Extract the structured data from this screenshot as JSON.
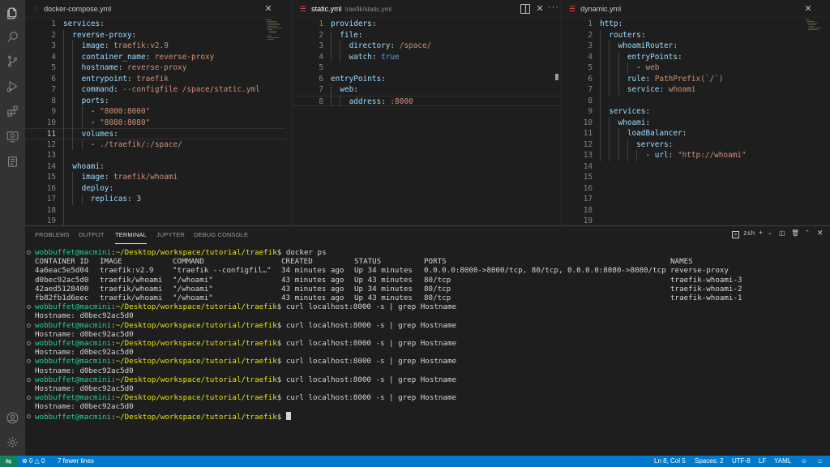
{
  "activity_bar": [
    {
      "name": "explorer-icon"
    },
    {
      "name": "search-icon"
    },
    {
      "name": "source-control-icon"
    },
    {
      "name": "run-debug-icon"
    },
    {
      "name": "extensions-icon"
    },
    {
      "name": "remote-explorer-icon"
    },
    {
      "name": "docker-icon"
    },
    {
      "name": "account-icon"
    },
    {
      "name": "settings-gear-icon"
    }
  ],
  "editors": {
    "compose": {
      "tab_label": "docker-compose.yml",
      "lines": [
        {
          "n": "1",
          "t": [
            [
              "k",
              "services"
            ],
            [
              "p",
              ":"
            ]
          ]
        },
        {
          "n": "2",
          "t": [
            [
              "p",
              "  "
            ],
            [
              "k",
              "reverse-proxy"
            ],
            [
              "p",
              ":"
            ]
          ]
        },
        {
          "n": "3",
          "t": [
            [
              "p",
              "    "
            ],
            [
              "k",
              "image"
            ],
            [
              "p",
              ": "
            ],
            [
              "s",
              "traefik:v2.9"
            ]
          ]
        },
        {
          "n": "4",
          "t": [
            [
              "p",
              "    "
            ],
            [
              "k",
              "container_name"
            ],
            [
              "p",
              ": "
            ],
            [
              "s",
              "reverse-proxy"
            ]
          ]
        },
        {
          "n": "5",
          "t": [
            [
              "p",
              "    "
            ],
            [
              "k",
              "hostname"
            ],
            [
              "p",
              ": "
            ],
            [
              "s",
              "reverse-proxy"
            ]
          ]
        },
        {
          "n": "6",
          "t": [
            [
              "p",
              "    "
            ],
            [
              "k",
              "entrypoint"
            ],
            [
              "p",
              ": "
            ],
            [
              "s",
              "traefik"
            ]
          ]
        },
        {
          "n": "7",
          "t": [
            [
              "p",
              "    "
            ],
            [
              "k",
              "command"
            ],
            [
              "p",
              ": "
            ],
            [
              "s",
              "--configfile /space/static.yml"
            ]
          ]
        },
        {
          "n": "8",
          "t": [
            [
              "p",
              "    "
            ],
            [
              "k",
              "ports"
            ],
            [
              "p",
              ":"
            ]
          ]
        },
        {
          "n": "9",
          "t": [
            [
              "p",
              "      - "
            ],
            [
              "s",
              "\"8000:8000\""
            ]
          ]
        },
        {
          "n": "10",
          "t": [
            [
              "p",
              "      - "
            ],
            [
              "s",
              "\"8080:8080\""
            ]
          ]
        },
        {
          "n": "11",
          "t": [
            [
              "p",
              "    "
            ],
            [
              "k",
              "volumes"
            ],
            [
              "p",
              ":"
            ]
          ]
        },
        {
          "n": "12",
          "t": [
            [
              "p",
              "      - "
            ],
            [
              "s",
              "./traefik/:/space/"
            ]
          ]
        },
        {
          "n": "13",
          "t": []
        },
        {
          "n": "14",
          "t": [
            [
              "p",
              "  "
            ],
            [
              "k",
              "whoami"
            ],
            [
              "p",
              ":"
            ]
          ]
        },
        {
          "n": "15",
          "t": [
            [
              "p",
              "    "
            ],
            [
              "k",
              "image"
            ],
            [
              "p",
              ": "
            ],
            [
              "s",
              "traefik/whoami"
            ]
          ]
        },
        {
          "n": "16",
          "t": [
            [
              "p",
              "    "
            ],
            [
              "k",
              "deploy"
            ],
            [
              "p",
              ":"
            ]
          ]
        },
        {
          "n": "17",
          "t": [
            [
              "p",
              "      "
            ],
            [
              "k",
              "replicas"
            ],
            [
              "p",
              ": "
            ],
            [
              "n",
              "3"
            ]
          ]
        },
        {
          "n": "18",
          "t": []
        },
        {
          "n": "19",
          "t": []
        }
      ]
    },
    "static": {
      "tab_label": "static.yml",
      "tab_path": "traefik/static.yml",
      "lines": [
        {
          "n": "1",
          "t": [
            [
              "k",
              "providers"
            ],
            [
              "p",
              ":"
            ]
          ]
        },
        {
          "n": "2",
          "t": [
            [
              "p",
              "  "
            ],
            [
              "k",
              "file"
            ],
            [
              "p",
              ":"
            ]
          ]
        },
        {
          "n": "3",
          "t": [
            [
              "p",
              "    "
            ],
            [
              "k",
              "directory"
            ],
            [
              "p",
              ": "
            ],
            [
              "s",
              "/space/"
            ]
          ]
        },
        {
          "n": "4",
          "t": [
            [
              "p",
              "    "
            ],
            [
              "k",
              "watch"
            ],
            [
              "p",
              ": "
            ],
            [
              "b",
              "true"
            ]
          ]
        },
        {
          "n": "5",
          "t": []
        },
        {
          "n": "6",
          "t": [
            [
              "k",
              "entryPoints"
            ],
            [
              "p",
              ":"
            ]
          ]
        },
        {
          "n": "7",
          "t": [
            [
              "p",
              "  "
            ],
            [
              "k",
              "web"
            ],
            [
              "p",
              ":"
            ]
          ]
        },
        {
          "n": "8",
          "t": [
            [
              "p",
              "    "
            ],
            [
              "k",
              "address"
            ],
            [
              "p",
              ": "
            ],
            [
              "s",
              ":8000"
            ]
          ]
        }
      ]
    },
    "dynamic": {
      "tab_label": "dynamic.yml",
      "lines": [
        {
          "n": "1",
          "t": [
            [
              "k",
              "http"
            ],
            [
              "p",
              ":"
            ]
          ]
        },
        {
          "n": "2",
          "t": [
            [
              "p",
              "  "
            ],
            [
              "k",
              "routers"
            ],
            [
              "p",
              ":"
            ]
          ]
        },
        {
          "n": "3",
          "t": [
            [
              "p",
              "    "
            ],
            [
              "k",
              "whoamiRouter"
            ],
            [
              "p",
              ":"
            ]
          ]
        },
        {
          "n": "4",
          "t": [
            [
              "p",
              "      "
            ],
            [
              "k",
              "entryPoints"
            ],
            [
              "p",
              ":"
            ]
          ]
        },
        {
          "n": "5",
          "t": [
            [
              "p",
              "        - "
            ],
            [
              "s",
              "web"
            ]
          ]
        },
        {
          "n": "6",
          "t": [
            [
              "p",
              "      "
            ],
            [
              "k",
              "rule"
            ],
            [
              "p",
              ": "
            ],
            [
              "s",
              "PathPrefix(`/`)"
            ]
          ]
        },
        {
          "n": "7",
          "t": [
            [
              "p",
              "      "
            ],
            [
              "k",
              "service"
            ],
            [
              "p",
              ": "
            ],
            [
              "s",
              "whoami"
            ]
          ]
        },
        {
          "n": "8",
          "t": []
        },
        {
          "n": "9",
          "t": [
            [
              "p",
              "  "
            ],
            [
              "k",
              "services"
            ],
            [
              "p",
              ":"
            ]
          ]
        },
        {
          "n": "10",
          "t": [
            [
              "p",
              "    "
            ],
            [
              "k",
              "whoami"
            ],
            [
              "p",
              ":"
            ]
          ]
        },
        {
          "n": "11",
          "t": [
            [
              "p",
              "      "
            ],
            [
              "k",
              "loadBalancer"
            ],
            [
              "p",
              ":"
            ]
          ]
        },
        {
          "n": "12",
          "t": [
            [
              "p",
              "        "
            ],
            [
              "k",
              "servers"
            ],
            [
              "p",
              ":"
            ]
          ]
        },
        {
          "n": "13",
          "t": [
            [
              "p",
              "          - "
            ],
            [
              "k",
              "url"
            ],
            [
              "p",
              ": "
            ],
            [
              "s",
              "\"http://whoami\""
            ]
          ]
        },
        {
          "n": "14",
          "t": []
        },
        {
          "n": "15",
          "t": []
        },
        {
          "n": "16",
          "t": []
        },
        {
          "n": "17",
          "t": []
        },
        {
          "n": "18",
          "t": []
        },
        {
          "n": "19",
          "t": []
        }
      ]
    }
  },
  "panel": {
    "tabs": [
      "PROBLEMS",
      "OUTPUT",
      "TERMINAL",
      "JUPYTER",
      "DEBUG CONSOLE"
    ],
    "active_tab": "TERMINAL",
    "shell": "zsh",
    "prompt_user": "wobbuffet@macmini",
    "prompt_path": "~/Desktop/workspace/tutorial/traefik",
    "docker_ps": {
      "command": "docker ps",
      "headers": [
        "CONTAINER ID",
        "IMAGE",
        "COMMAND",
        "CREATED",
        "STATUS",
        "PORTS",
        "NAMES"
      ],
      "rows": [
        [
          "4a6eac5e5d04",
          "traefik:v2.9",
          "\"traefik --configfil…\"",
          "34 minutes ago",
          "Up 34 minutes",
          "0.0.0.0:8000->8000/tcp, 80/tcp, 0.0.0.0:8080->8080/tcp",
          "reverse-proxy"
        ],
        [
          "d0bec92ac5d0",
          "traefik/whoami",
          "\"/whoami\"",
          "43 minutes ago",
          "Up 43 minutes",
          "80/tcp",
          "traefik-whoami-3"
        ],
        [
          "42aed5128400",
          "traefik/whoami",
          "\"/whoami\"",
          "43 minutes ago",
          "Up 34 minutes",
          "80/tcp",
          "traefik-whoami-2"
        ],
        [
          "fb82fb1d6eec",
          "traefik/whoami",
          "\"/whoami\"",
          "43 minutes ago",
          "Up 43 minutes",
          "80/tcp",
          "traefik-whoami-1"
        ]
      ]
    },
    "curl_command": "curl localhost:8000 -s | grep Hostname",
    "curl_outputs": [
      "Hostname: d0bec92ac5d0",
      "Hostname: d0bec92ac5d0",
      "Hostname: d0bec92ac5d0",
      "Hostname: d0bec92ac5d0",
      "Hostname: d0bec92ac5d0",
      "Hostname: d0bec92ac5d0"
    ]
  },
  "status_bar": {
    "errors": "0",
    "warnings": "0",
    "message": "7 fewer lines",
    "position": "Ln 8, Col 5",
    "spaces": "Spaces: 2",
    "encoding": "UTF-8",
    "eol": "LF",
    "language": "YAML"
  },
  "colors": {
    "activity_bar": "#333333",
    "editor_bg": "#1e1e1e",
    "status_bar": "#007acc",
    "remote_indicator": "#16825d",
    "prompt_user": "#23d18b",
    "prompt_path": "#e5e510",
    "yaml_key": "#9cdcfe",
    "yaml_string": "#ce9178",
    "yaml_number": "#b5cea8",
    "yaml_bool": "#569cd6"
  }
}
